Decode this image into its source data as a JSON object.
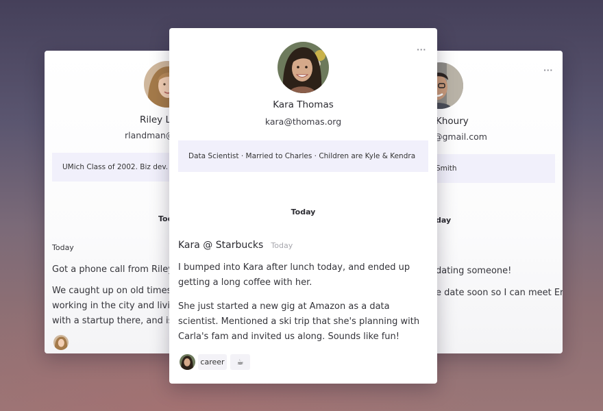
{
  "left_card": {
    "name": "Riley La",
    "email": "rlandman@",
    "note": "UMich Class of 2002. Biz dev.",
    "day_heading": "Tod",
    "date": "Today",
    "p1": "Got a phone call from Riley today.",
    "p2_lines": [
      "We caught up on old times. She's",
      "working in the city and living in Br",
      "with a startup there, and is enjoyin"
    ]
  },
  "main_card": {
    "name": "Kara Thomas",
    "email": "kara@thomas.org",
    "note": "Data Scientist · Married to Charles · Children are Kyle & Kendra",
    "day_heading": "Today",
    "entry_title": "Kara @ Starbucks",
    "entry_date": "Today",
    "p1": "I bumped into Kara after lunch today, and ended up getting a long coffee with her.",
    "p2": "She just started a new gig at Amazon as a data scientist. Mentioned a ski trip that she's planning with Carla's fam and invited us along. Sounds like fun!",
    "tags": [
      "career",
      "☕"
    ]
  },
  "right_card": {
    "name": "Khoury",
    "email": "@gmail.com",
    "note": "Smith",
    "day_heading": "day",
    "p1": "dating someone!",
    "p2": "e date soon so I can meet Erin :)"
  },
  "menu_icon": "···"
}
